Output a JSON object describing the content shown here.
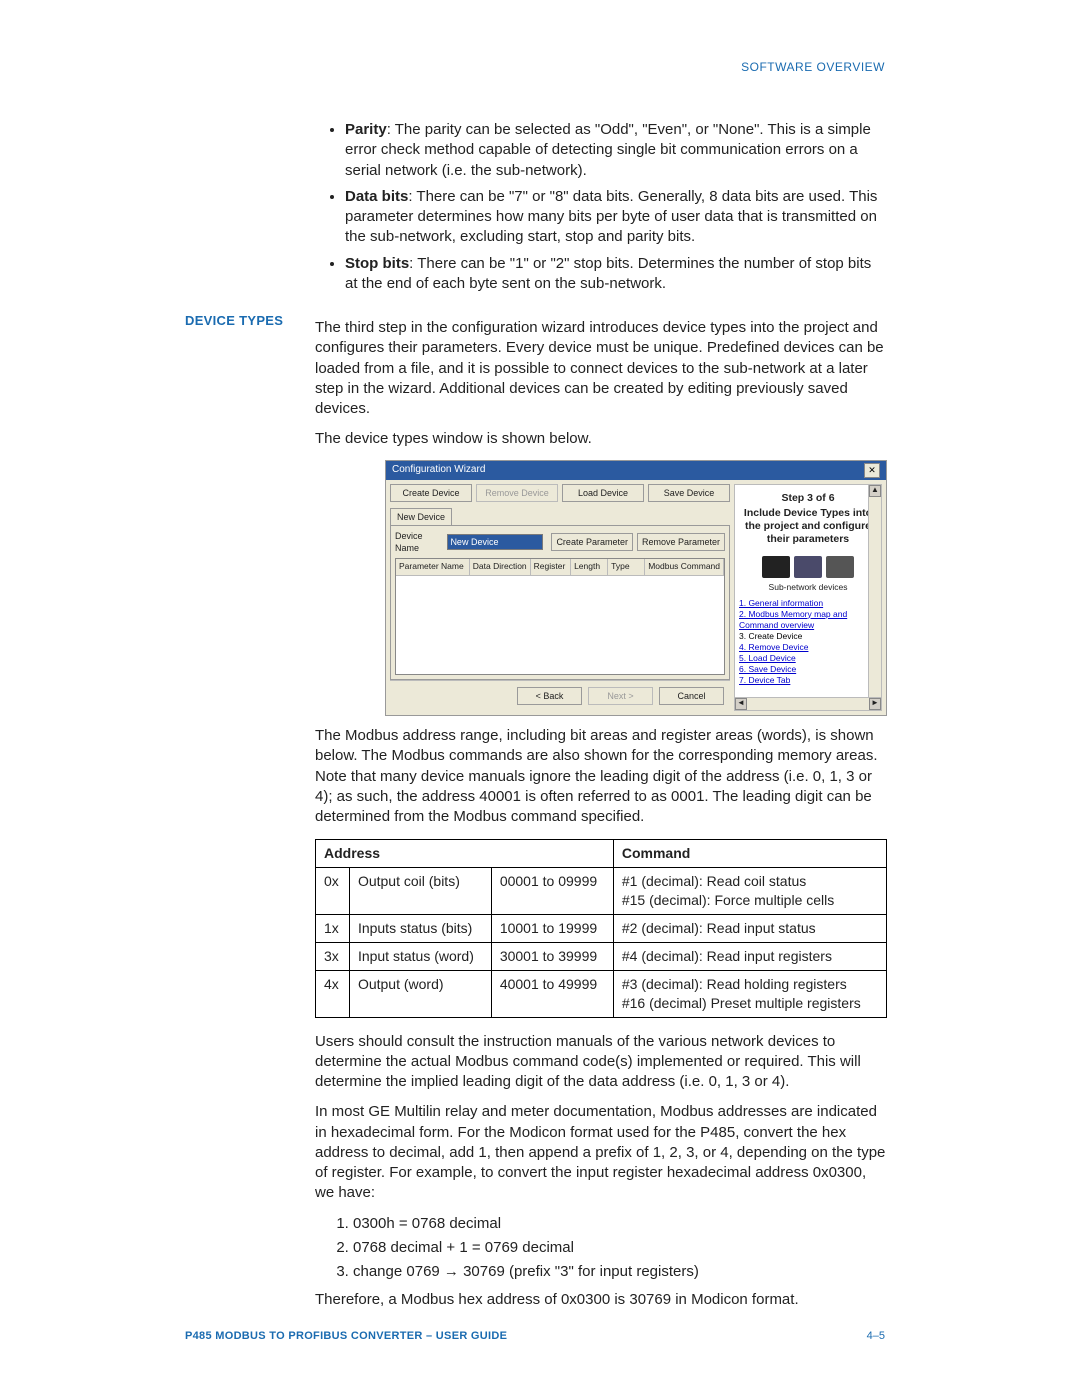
{
  "header": {
    "right": "SOFTWARE OVERVIEW"
  },
  "bullets": [
    {
      "term": "Parity",
      "text": ": The parity can be selected as \"Odd\", \"Even\", or \"None\". This is a simple error check method capable of detecting single bit communication errors on a serial network (i.e. the sub-network)."
    },
    {
      "term": "Data bits",
      "text": ": There can be \"7\" or \"8\" data bits. Generally, 8 data bits are used. This parameter determines how many bits per byte of user data that is transmitted on the sub-network, excluding start, stop and parity bits."
    },
    {
      "term": "Stop bits",
      "text": ": There can be \"1\" or \"2\" stop bits. Determines the number of stop bits at the end of each byte sent on the sub-network."
    }
  ],
  "section": {
    "label": "DEVICE TYPES",
    "intro": "The third step in the configuration wizard introduces device types into the project and configures their parameters. Every device must be unique. Predefined devices can be loaded from a file, and it is possible to connect devices to the sub-network at a later step in the wizard. Additional devices can be created by editing previously saved devices.",
    "caption": "The device types window is shown below."
  },
  "wizard": {
    "title": "Configuration Wizard",
    "buttons": {
      "create": "Create Device",
      "remove": "Remove Device",
      "load": "Load Device",
      "save": "Save Device"
    },
    "tab": "New Device",
    "device_name_label": "Device Name",
    "device_name_value": "New Device",
    "create_param": "Create Parameter",
    "remove_param": "Remove Parameter",
    "grid_headers": [
      "Parameter Name",
      "Data Direction",
      "Register",
      "Length",
      "Type",
      "Modbus Command"
    ],
    "footer": {
      "back": "< Back",
      "next": "Next >",
      "cancel": "Cancel"
    },
    "side": {
      "step": "Step 3 of 6",
      "heading": "Include Device Types into the project and configure their parameters",
      "subnet": "Sub-network devices",
      "links": [
        "1. General information",
        "2. Modbus Memory map and Command overview",
        "3. Create Device",
        "4. Remove Device",
        "5. Load Device",
        "6. Save Device",
        "7. Device Tab"
      ]
    }
  },
  "after_wizard": "The Modbus address range, including bit areas and register areas (words), is shown below. The Modbus commands are also shown for the corresponding memory areas. Note that many device manuals ignore the leading digit of the address (i.e. 0, 1, 3 or 4); as such, the address 40001 is often referred to as 0001. The leading digit can be determined from the Modbus command specified.",
  "table": {
    "headers": {
      "address": "Address",
      "command": "Command"
    },
    "rows": [
      {
        "prefix": "0x",
        "name": "Output coil (bits)",
        "range": "00001 to 09999",
        "command": "#1 (decimal): Read coil status\n#15 (decimal): Force multiple cells"
      },
      {
        "prefix": "1x",
        "name": "Inputs status (bits)",
        "range": "10001 to 19999",
        "command": "#2 (decimal): Read input status"
      },
      {
        "prefix": "3x",
        "name": "Input status (word)",
        "range": "30001 to 39999",
        "command": "#4 (decimal): Read input registers"
      },
      {
        "prefix": "4x",
        "name": "Output (word)",
        "range": "40001 to 49999",
        "command": "#3 (decimal): Read holding registers\n#16 (decimal) Preset multiple registers"
      }
    ]
  },
  "post_table": {
    "p1": "Users should consult the instruction manuals of the various network devices to determine the actual Modbus command code(s) implemented or required. This will determine the implied leading digit of the data address (i.e. 0, 1, 3 or 4).",
    "p2": "In most GE Multilin relay and meter documentation, Modbus addresses are indicated in hexadecimal form. For the Modicon format used for the P485, convert the hex address to decimal, add 1, then append a prefix of 1, 2, 3, or 4, depending on the type of register. For example, to convert the input register hexadecimal address 0x0300, we have:",
    "steps": [
      "0300h = 0768 decimal",
      "0768 decimal + 1 = 0769 decimal",
      "change 0769 → 30769 (prefix \"3\" for input registers)"
    ],
    "p3": "Therefore, a Modbus hex address of 0x0300 is 30769 in Modicon format."
  },
  "footer": {
    "left": "P485 MODBUS TO PROFIBUS CONVERTER – USER GUIDE",
    "right": "4–5"
  }
}
